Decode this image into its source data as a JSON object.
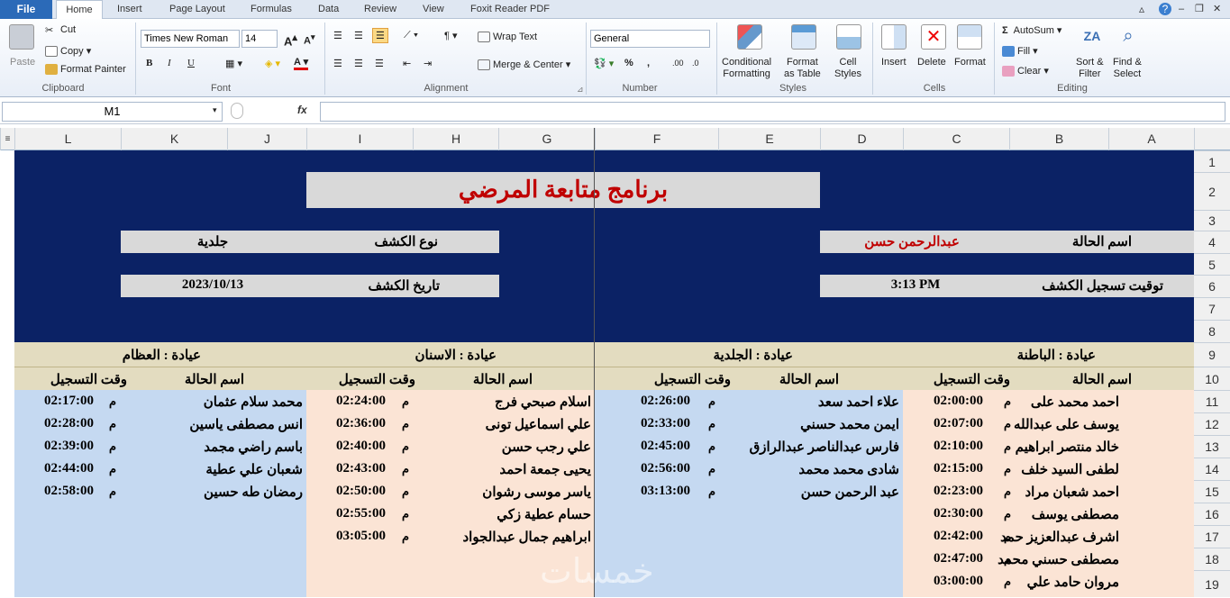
{
  "ribbon": {
    "file": "File",
    "tabs": [
      "Home",
      "Insert",
      "Page Layout",
      "Formulas",
      "Data",
      "Review",
      "View",
      "Foxit Reader PDF"
    ],
    "paste": "Paste",
    "cut": "Cut",
    "copy": "Copy",
    "format_painter": "Format Painter",
    "clipboard": "Clipboard",
    "font_name": "Times New Roman",
    "font_size": "14",
    "font_group": "Font",
    "bold": "B",
    "italic": "I",
    "underline": "U",
    "wrap_text": "Wrap Text",
    "merge_center": "Merge & Center",
    "alignment": "Alignment",
    "number_format": "General",
    "number": "Number",
    "percent": "%",
    "comma": ",",
    "cond_format": "Conditional",
    "cond_format2": "Formatting",
    "format_table": "Format",
    "format_table2": "as Table",
    "cell_styles": "Cell",
    "cell_styles2": "Styles",
    "styles": "Styles",
    "insert": "Insert",
    "delete": "Delete",
    "format": "Format",
    "cells": "Cells",
    "autosum": "AutoSum",
    "fill": "Fill",
    "clear": "Clear",
    "sort_filter": "Sort &",
    "sort_filter2": "Filter",
    "find_select": "Find &",
    "find_select2": "Select",
    "editing": "Editing"
  },
  "formula_bar": {
    "name_box": "M1",
    "fx": "fx",
    "value": ""
  },
  "columns": [
    "L",
    "K",
    "J",
    "I",
    "H",
    "G",
    "F",
    "E",
    "D",
    "C",
    "B",
    "A"
  ],
  "rows": [
    "1",
    "2",
    "3",
    "4",
    "5",
    "6",
    "7",
    "8",
    "9",
    "10",
    "11",
    "12",
    "13",
    "14",
    "15",
    "16",
    "17",
    "18",
    "19"
  ],
  "sheet": {
    "title": "برنامج متابعة المرضي",
    "case_name_label": "اسم الحالة",
    "case_name": "عبدالرحمن حسن",
    "reg_time_label": "توقيت تسجيل الكشف",
    "reg_time": "3:13 PM",
    "exam_type_label": "نوع الكشف",
    "exam_type": "جلدية",
    "exam_date_label": "تاريخ الكشف",
    "exam_date": "2023/10/13",
    "clinics": [
      {
        "name": "عيادة : الباطنة",
        "col_name": "اسم الحالة",
        "col_time": "وقت التسجيل",
        "entries": [
          [
            "احمد محمد على",
            "02:00:00",
            "م"
          ],
          [
            "يوسف على عبدالله",
            "02:07:00",
            "م"
          ],
          [
            "خالد منتصر ابراهيم",
            "02:10:00",
            "م"
          ],
          [
            "لطفى السيد خلف",
            "02:15:00",
            "م"
          ],
          [
            "احمد شعبان مراد",
            "02:23:00",
            "م"
          ],
          [
            "مصطفى يوسف",
            "02:30:00",
            "م"
          ],
          [
            "اشرف عبدالعزيز حمد",
            "02:42:00",
            "م"
          ],
          [
            "مصطفى حسني محمد",
            "02:47:00",
            "م"
          ],
          [
            "مروان حامد علي",
            "03:00:00",
            "م"
          ]
        ]
      },
      {
        "name": "عيادة : الجلدية",
        "col_name": "اسم الحالة",
        "col_time": "وقت التسجيل",
        "entries": [
          [
            "علاء احمد سعد",
            "02:26:00",
            "م"
          ],
          [
            "ايمن محمد حسني",
            "02:33:00",
            "م"
          ],
          [
            "فارس عبدالناصر عبدالرازق",
            "02:45:00",
            "م"
          ],
          [
            "شادى محمد محمد",
            "02:56:00",
            "م"
          ],
          [
            "عبد الرحمن حسن",
            "03:13:00",
            "م"
          ]
        ]
      },
      {
        "name": "عيادة : الاسنان",
        "col_name": "اسم الحالة",
        "col_time": "وقت التسجيل",
        "entries": [
          [
            "اسلام صبحي فرج",
            "02:24:00",
            "م"
          ],
          [
            "علي اسماعيل تونى",
            "02:36:00",
            "م"
          ],
          [
            "علي رجب  حسن",
            "02:40:00",
            "م"
          ],
          [
            "يحيى جمعة احمد",
            "02:43:00",
            "م"
          ],
          [
            "ياسر موسى رشوان",
            "02:50:00",
            "م"
          ],
          [
            "حسام عطية زكي",
            "02:55:00",
            "م"
          ],
          [
            "ابراهيم جمال عبدالجواد",
            "03:05:00",
            "م"
          ]
        ]
      },
      {
        "name": "عيادة : العظام",
        "col_name": "اسم الحالة",
        "col_time": "وقت التسجيل",
        "entries": [
          [
            "محمد سلام عثمان",
            "02:17:00",
            "م"
          ],
          [
            "انس مصطفى ياسين",
            "02:28:00",
            "م"
          ],
          [
            "باسم راضي مجمد",
            "02:39:00",
            "م"
          ],
          [
            "شعبان علي عطية",
            "02:44:00",
            "م"
          ],
          [
            "رمضان طه حسين",
            "02:58:00",
            "م"
          ]
        ]
      }
    ]
  },
  "colors": {
    "header_bg": "#0b2265",
    "label_bg": "#d9d9d9",
    "title_text": "#c00000",
    "clinic_bg": "#e3dcc0",
    "peach": "#fbe4d5",
    "blue": "#c5d9f1"
  }
}
